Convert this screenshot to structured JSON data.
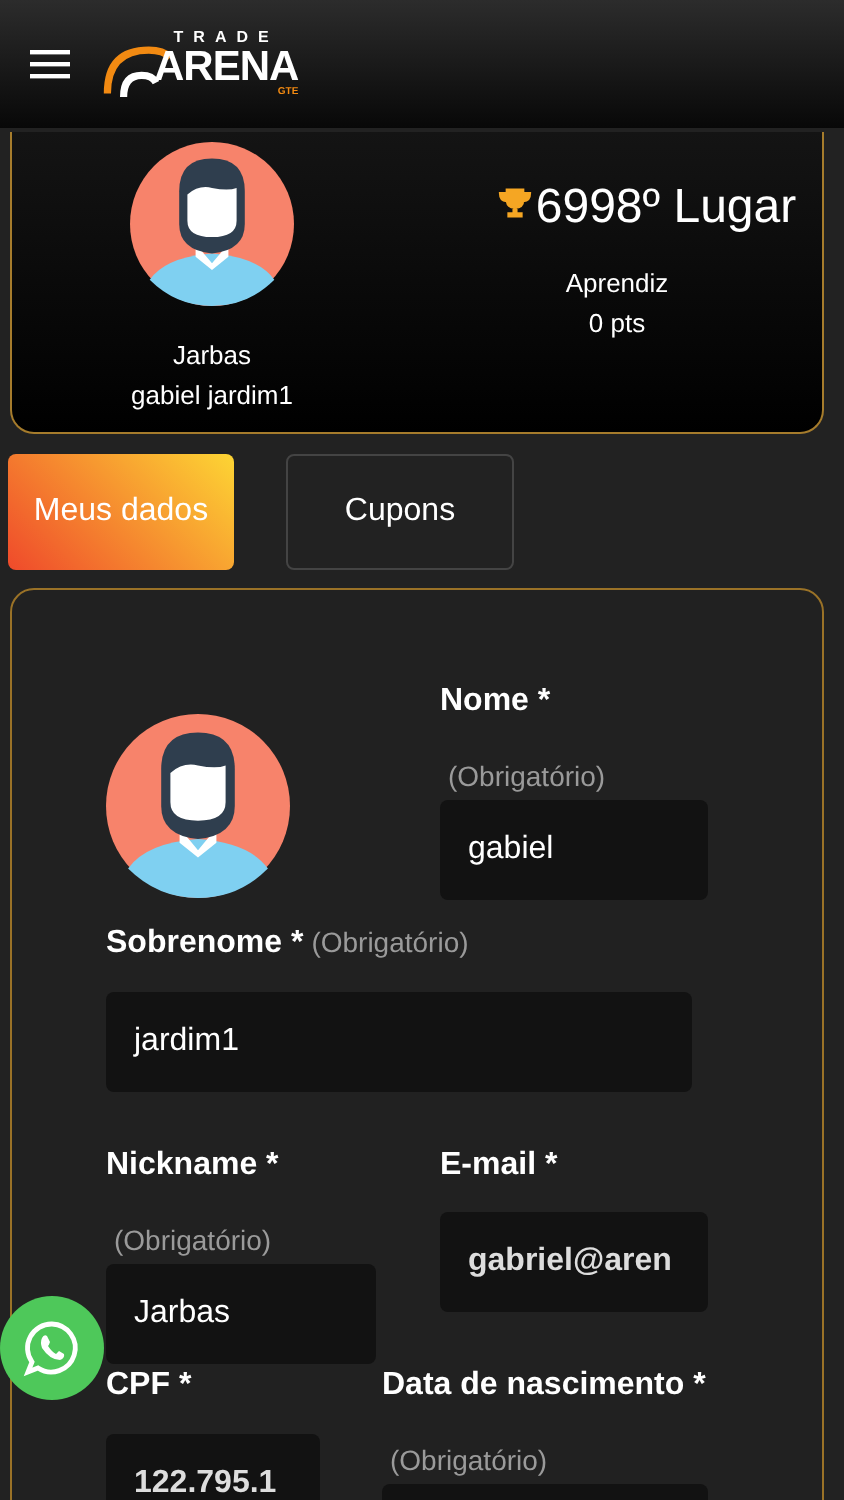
{
  "header": {
    "logo": {
      "top": "TRADE",
      "main": "ARENA",
      "sub": "GTE"
    }
  },
  "profile": {
    "nickname": "Jarbas",
    "full_name": "gabiel jardim1",
    "rank": "6998º Lugar",
    "level_name": "Aprendiz",
    "points": "0 pts"
  },
  "tabs": [
    {
      "label": "Meus dados",
      "selected": true
    },
    {
      "label": "Cupons",
      "selected": false
    }
  ],
  "form": {
    "first_name": {
      "label": "Nome *",
      "hint": "(Obrigatório)",
      "value": "gabiel"
    },
    "last_name": {
      "label": "Sobrenome *",
      "hint": "(Obrigatório)",
      "value": "jardim1"
    },
    "nickname": {
      "label": "Nickname *",
      "hint": "(Obrigatório)",
      "value": "Jarbas"
    },
    "email": {
      "label": "E-mail *",
      "value": "gabriel@aren"
    },
    "cpf": {
      "label": "CPF *",
      "value": "122.795.1"
    },
    "birth_date": {
      "label": "Data de nascimento *",
      "hint": "(Obrigatório)"
    }
  }
}
